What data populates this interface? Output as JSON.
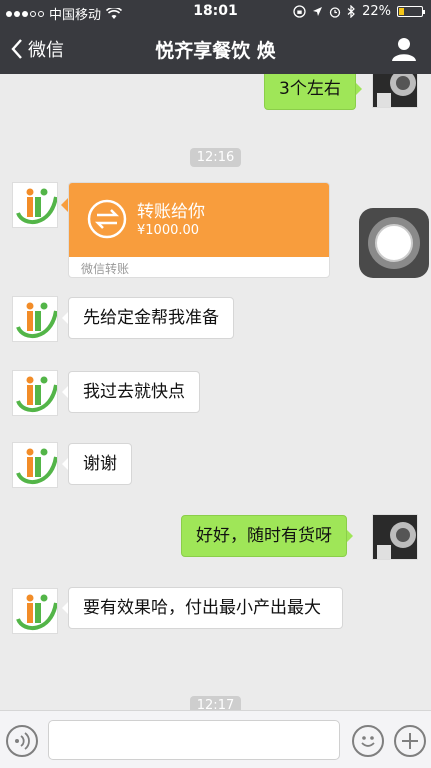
{
  "status_bar": {
    "carrier": "中国移动",
    "time": "18:01",
    "battery": "22%",
    "battery_level": 0.22
  },
  "nav": {
    "back_label": "微信",
    "title": "悦齐享餐饮 焕"
  },
  "messages": [
    {
      "side": "out",
      "text": "3个左右"
    },
    {
      "type": "time",
      "text": "12:16"
    },
    {
      "side": "in",
      "type": "transfer",
      "title": "转账给你",
      "amount": "¥1000.00",
      "footer": "微信转账"
    },
    {
      "side": "in",
      "text": "先给定金帮我准备"
    },
    {
      "side": "in",
      "text": "我过去就快点"
    },
    {
      "side": "in",
      "text": "谢谢"
    },
    {
      "side": "out",
      "text": "好好，随时有货呀"
    },
    {
      "side": "in",
      "text": "要有效果哈，付出最小产出最大"
    },
    {
      "type": "time",
      "text": "12:17"
    }
  ],
  "colors": {
    "nav_bg": "#393a3f",
    "chat_bg": "#ebebeb",
    "out_bubble": "#9fe658",
    "transfer_orange": "#f89d3d"
  },
  "icons": {
    "back": "chevron-left-icon",
    "profile": "person-icon",
    "voice": "voice-icon",
    "emoji": "emoji-icon",
    "more": "plus-icon"
  },
  "input": {
    "value": ""
  }
}
